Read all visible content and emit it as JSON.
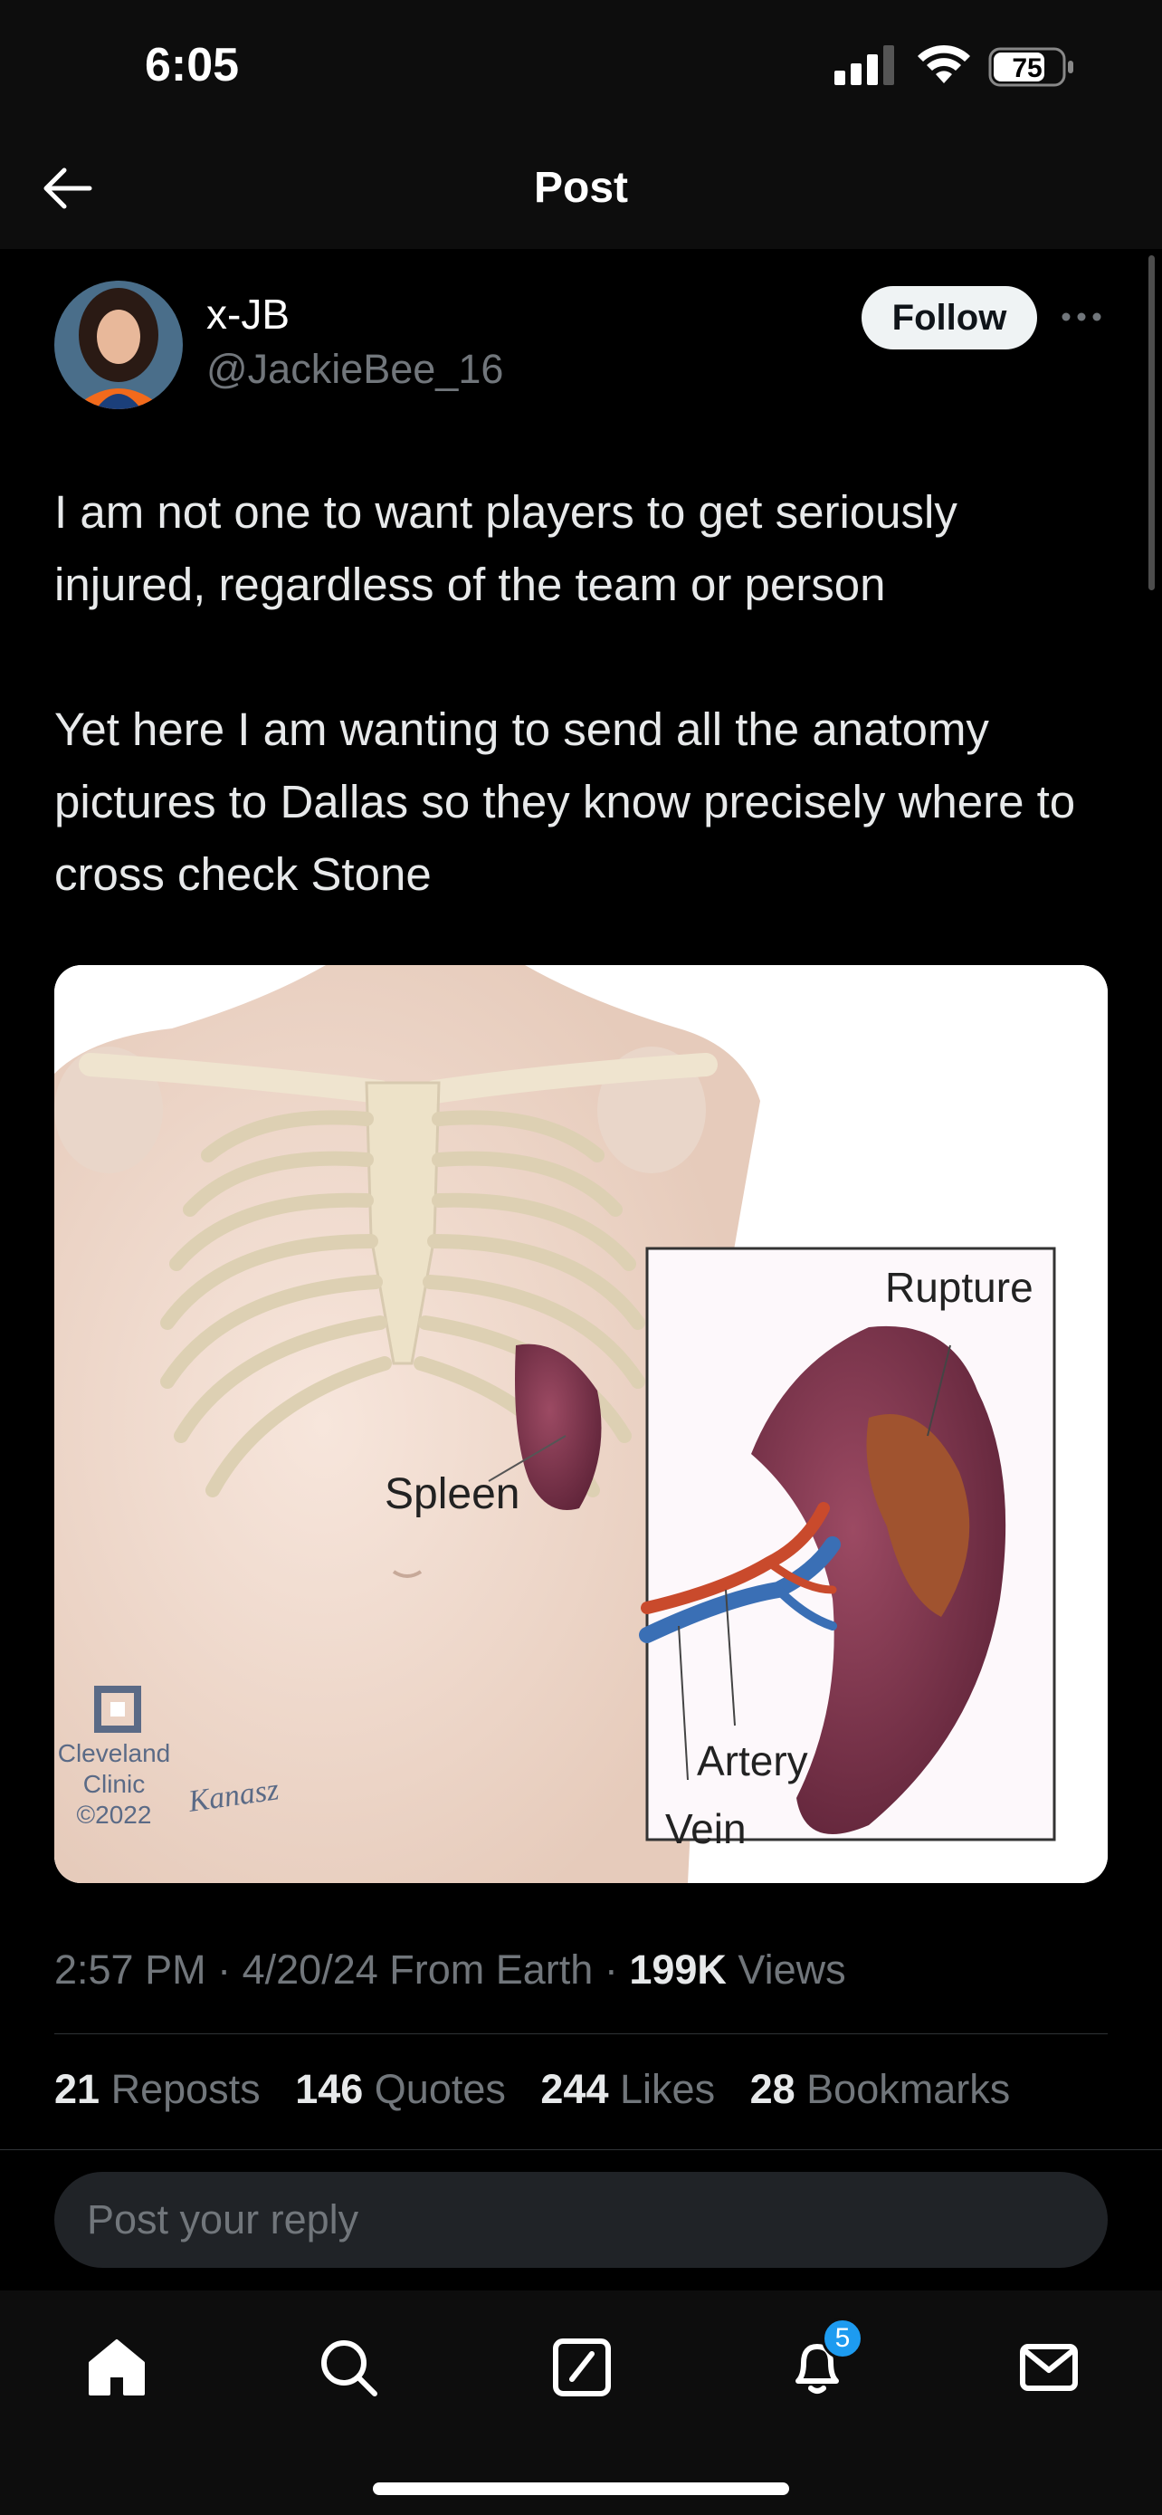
{
  "status_bar": {
    "time": "6:05",
    "battery": "75"
  },
  "header": {
    "title": "Post"
  },
  "author": {
    "name": "x-JB",
    "handle": "@JackieBee_16",
    "follow_label": "Follow"
  },
  "post": {
    "paragraphs": [
      "I am not one to want players to get seriously injured, regardless of the team or person",
      "Yet here I am wanting to send all the anatomy pictures to Dallas so they know precisely where to cross check Stone"
    ],
    "image": {
      "labels": {
        "spleen": "Spleen",
        "rupture": "Rupture",
        "artery": "Artery",
        "vein": "Vein"
      },
      "logo": {
        "line1": "Cleveland",
        "line2": "Clinic",
        "line3": "©2022"
      },
      "signature": "Kanasz"
    }
  },
  "meta": {
    "time": "2:57 PM",
    "date": "4/20/24",
    "source": "From Earth",
    "views_count": "199K",
    "views_label": "Views"
  },
  "stats": [
    {
      "count": "21",
      "label": "Reposts"
    },
    {
      "count": "146",
      "label": "Quotes"
    },
    {
      "count": "244",
      "label": "Likes"
    },
    {
      "count": "28",
      "label": "Bookmarks"
    }
  ],
  "reply": {
    "placeholder": "Post your reply"
  },
  "bottom_nav": {
    "items": [
      {
        "icon": "home-icon"
      },
      {
        "icon": "search-icon"
      },
      {
        "icon": "compose-icon"
      },
      {
        "icon": "bell-icon",
        "badge": "5"
      },
      {
        "icon": "mail-icon"
      }
    ]
  },
  "colors": {
    "accent": "#1d9bf0",
    "muted": "#71767b",
    "background": "#000000"
  }
}
